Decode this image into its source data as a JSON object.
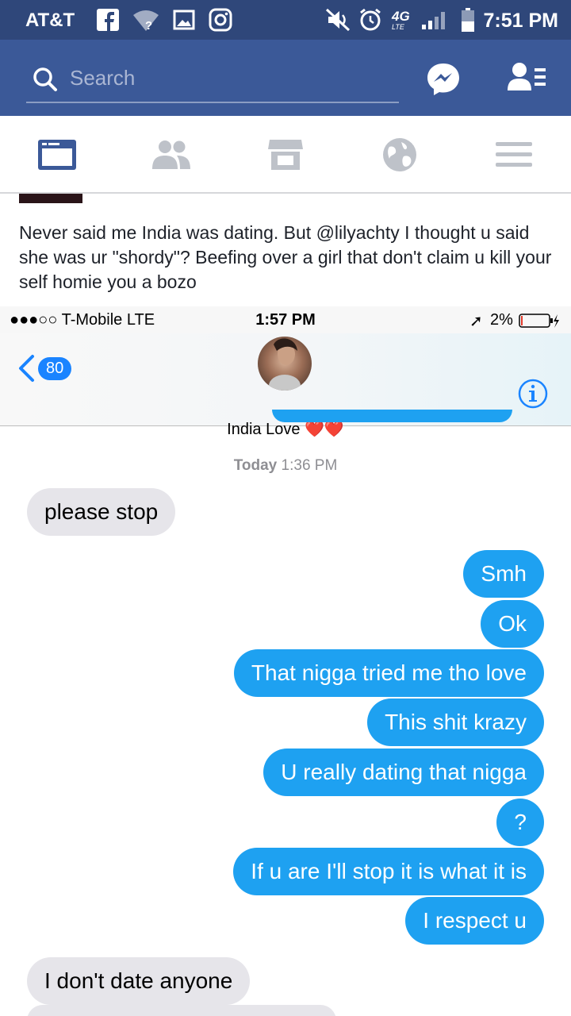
{
  "android_status": {
    "carrier": "AT&T",
    "network": "4G",
    "network_sub": "LTE",
    "time": "7:51 PM",
    "icons": [
      "facebook-icon",
      "wifi-unknown-icon",
      "image-icon",
      "instagram-icon",
      "mute-icon",
      "alarm-icon",
      "signal-icon",
      "battery-icon"
    ]
  },
  "fb_header": {
    "search_placeholder": "Search",
    "icons": [
      "search-icon",
      "messenger-icon",
      "friend-requests-icon"
    ],
    "accent": "#3b5998"
  },
  "fb_tabs": [
    {
      "name": "news-feed",
      "icon": "news-feed-icon",
      "active": true
    },
    {
      "name": "friends",
      "icon": "friends-icon",
      "active": false
    },
    {
      "name": "marketplace",
      "icon": "marketplace-icon",
      "active": false
    },
    {
      "name": "notifications",
      "icon": "globe-icon",
      "active": false
    },
    {
      "name": "menu",
      "icon": "menu-icon",
      "active": false
    }
  ],
  "post": {
    "text": "Never said me India was dating. But @lilyachty I thought u said she was ur \"shordy\"? Beefing over a girl that don't claim u kill your self homie you a bozo"
  },
  "imessage": {
    "status": {
      "carrier": "●●●○○ T-Mobile  LTE",
      "time": "1:57 PM",
      "battery": "2%"
    },
    "back_count": "80",
    "contact": "India Love ❤️❤️",
    "timestamp_day": "Today",
    "timestamp_time": "1:36 PM",
    "messages": [
      {
        "dir": "in",
        "text": "please stop"
      },
      {
        "dir": "out",
        "text": "Smh"
      },
      {
        "dir": "out",
        "text": "Ok"
      },
      {
        "dir": "out",
        "text": "That nigga tried me tho love"
      },
      {
        "dir": "out",
        "text": "This shit krazy"
      },
      {
        "dir": "out",
        "text": "U really dating that nigga"
      },
      {
        "dir": "out",
        "text": "?"
      },
      {
        "dir": "out",
        "text": "If u are I'll stop it is what it is"
      },
      {
        "dir": "out",
        "text": "I respect u"
      },
      {
        "dir": "in",
        "text": "I don't date anyone"
      }
    ],
    "colors": {
      "outgoing": "#1ea1f1",
      "incoming": "#e6e5ea"
    }
  }
}
